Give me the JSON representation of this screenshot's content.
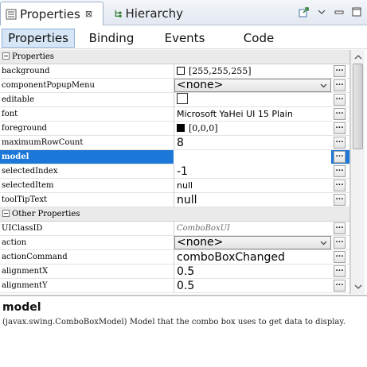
{
  "view_tabs": {
    "properties": {
      "label": "Properties",
      "close": "⊠"
    },
    "hierarchy": {
      "label": "Hierarchy"
    }
  },
  "sub_tabs": [
    "Properties",
    "Binding",
    "Events",
    "Code"
  ],
  "categories": {
    "properties": "Properties",
    "other": "Other Properties"
  },
  "rows": {
    "background": {
      "name": "background",
      "value": "[255,255,255]",
      "swatch": "#ffffff"
    },
    "componentPopupMenu": {
      "name": "componentPopupMenu",
      "value": "<none>"
    },
    "editable": {
      "name": "editable",
      "value": ""
    },
    "font": {
      "name": "font",
      "value": "Microsoft YaHei UI 15 Plain"
    },
    "foreground": {
      "name": "foreground",
      "value": "[0,0,0]",
      "swatch": "#000000"
    },
    "maximumRowCount": {
      "name": "maximumRowCount",
      "value": "8"
    },
    "model": {
      "name": "model",
      "value": ""
    },
    "selectedIndex": {
      "name": "selectedIndex",
      "value": "-1"
    },
    "selectedItem": {
      "name": "selectedItem",
      "value": "null"
    },
    "toolTipText": {
      "name": "toolTipText",
      "value": "null"
    },
    "UIClassID": {
      "name": "UIClassID",
      "value": "ComboBoxUI"
    },
    "action": {
      "name": "action",
      "value": "<none>"
    },
    "actionCommand": {
      "name": "actionCommand",
      "value": "comboBoxChanged"
    },
    "alignmentX": {
      "name": "alignmentX",
      "value": "0.5"
    },
    "alignmentY": {
      "name": "alignmentY",
      "value": "0.5"
    }
  },
  "ellipsis": "...",
  "description": {
    "title": "model",
    "text": "(javax.swing.ComboBoxModel)  Model that the combo box uses to get data to display."
  },
  "colors": {
    "selection": "#1c77d8",
    "subtab_selected": "#d6e6f6"
  }
}
